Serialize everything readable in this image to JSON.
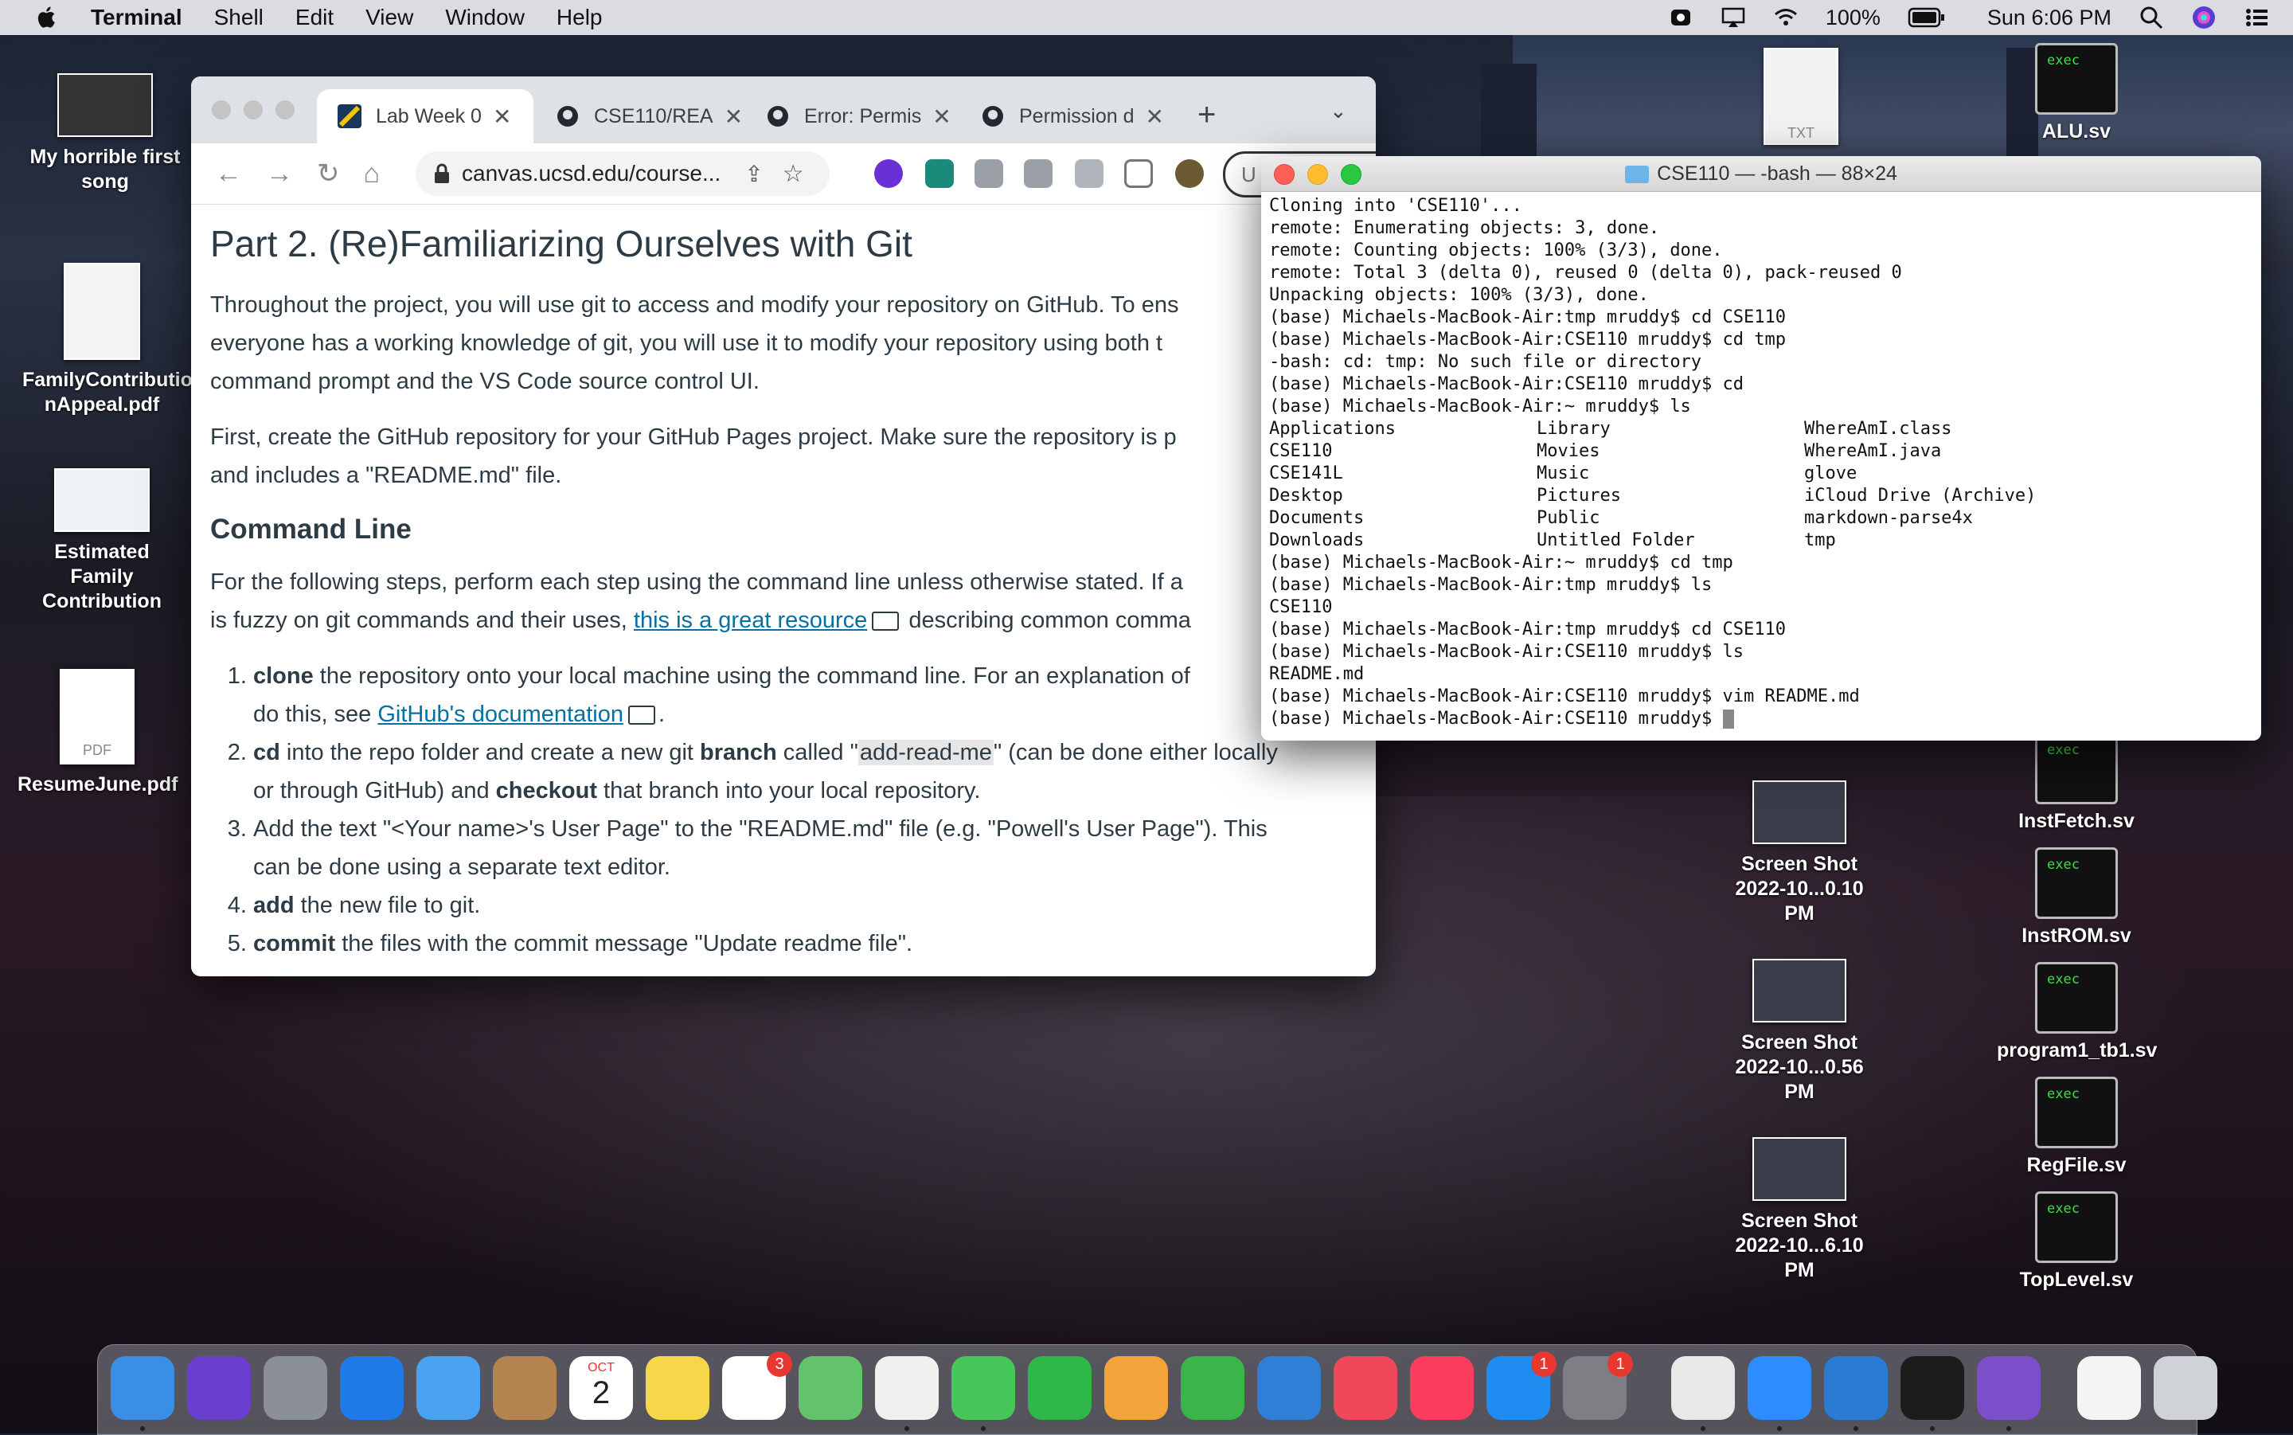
{
  "menubar": {
    "app": "Terminal",
    "items": [
      "Shell",
      "Edit",
      "View",
      "Window",
      "Help"
    ],
    "battery": "100%",
    "clock": "Sun 6:06 PM"
  },
  "desktop_left": [
    {
      "label_line1": "My horrible first",
      "label_line2": "song"
    },
    {
      "label_line1": "FamilyContributio",
      "label_line2": "nAppeal.pdf"
    },
    {
      "label_line1": "Estimated Family",
      "label_line2": "Contribution"
    },
    {
      "label_line1": "ResumeJune.pdf",
      "label_line2": "",
      "badge": "PDF"
    }
  ],
  "desktop_right": {
    "txt_badge": "TXT",
    "screenshots": [
      {
        "line1": "Screen Shot",
        "line2": "2022-10...0.10 PM"
      },
      {
        "line1": "Screen Shot",
        "line2": "2022-10...0.56 PM"
      },
      {
        "line1": "Screen Shot",
        "line2": "2022-10...6.10 PM"
      }
    ],
    "exec_label": "exec",
    "exec_files": [
      "ALU.sv",
      "InstFetch.sv",
      "InstROM.sv",
      "program1_tb1.sv",
      "RegFile.sv",
      "TopLevel.sv"
    ]
  },
  "browser": {
    "tabs": [
      {
        "label": "Lab Week 0"
      },
      {
        "label": "CSE110/REA"
      },
      {
        "label": "Error: Permis"
      },
      {
        "label": "Permission d"
      }
    ],
    "url": "canvas.ucsd.edu/course...",
    "omnibox_right": "U",
    "page": {
      "title": "Part 2. (Re)Familiarizing Ourselves with Git",
      "p1_l1": "Throughout the project, you will use git to access and modify your repository on GitHub. To ens",
      "p1_l2": "everyone has a working knowledge of git, you will use it to modify your repository using both t",
      "p1_l3": "command prompt and the VS Code source control UI.",
      "p2_l1": "First, create the GitHub repository for your GitHub Pages project. Make sure the repository is p",
      "p2_l2": "and includes a \"README.md\" file.",
      "h3": "Command Line",
      "p3_l1": "For the following steps, perform each step using the command line unless otherwise stated. If a",
      "p3_l2a": "is fuzzy on git commands and their uses,",
      "p3_link": "this is a great resource",
      "p3_l2b": "describing common comma",
      "li1_bold": "clone",
      "li1_l1": " the repository onto your local machine using the command line. For an explanation of",
      "li1_l2a": "do this, see ",
      "li1_link": "GitHub's documentation",
      "li2_bold1": "cd",
      "li2_a": " into the repo folder and create a new git ",
      "li2_bold2": "branch",
      "li2_b": " called \"",
      "li2_code": "add-read-me",
      "li2_c": "\" (can be done either locally",
      "li2_l2a": "or through GitHub) and ",
      "li2_bold3": "checkout",
      "li2_l2b": " that branch into your local repository.",
      "li3_l1": "Add the text \"<Your name>'s User Page\" to the \"README.md\" file (e.g. \"Powell's User Page\"). This",
      "li3_l2": "can be done using a separate text editor.",
      "li4_bold": "add",
      "li4_rest": " the new file to git.",
      "li5_bold": "commit",
      "li5_rest": " the files with the commit message \"Update readme file\"."
    }
  },
  "terminal": {
    "title": "CSE110 — -bash — 88×24",
    "lines_top": [
      "Cloning into 'CSE110'...",
      "remote: Enumerating objects: 3, done.",
      "remote: Counting objects: 100% (3/3), done.",
      "remote: Total 3 (delta 0), reused 0 (delta 0), pack-reused 0",
      "Unpacking objects: 100% (3/3), done.",
      "(base) Michaels-MacBook-Air:tmp mruddy$ cd CSE110",
      "(base) Michaels-MacBook-Air:CSE110 mruddy$ cd tmp",
      "-bash: cd: tmp: No such file or directory",
      "(base) Michaels-MacBook-Air:CSE110 mruddy$ cd",
      "(base) Michaels-MacBook-Air:~ mruddy$ ls"
    ],
    "ls_rows": [
      [
        "Applications",
        "Library",
        "WhereAmI.class"
      ],
      [
        "CSE110",
        "Movies",
        "WhereAmI.java"
      ],
      [
        "CSE141L",
        "Music",
        "glove"
      ],
      [
        "Desktop",
        "Pictures",
        "iCloud Drive (Archive)"
      ],
      [
        "Documents",
        "Public",
        "markdown-parse4x"
      ],
      [
        "Downloads",
        "Untitled Folder",
        "tmp"
      ]
    ],
    "lines_bottom": [
      "(base) Michaels-MacBook-Air:~ mruddy$ cd tmp",
      "(base) Michaels-MacBook-Air:tmp mruddy$ ls",
      "CSE110",
      "(base) Michaels-MacBook-Air:tmp mruddy$ cd CSE110",
      "(base) Michaels-MacBook-Air:CSE110 mruddy$ ls",
      "README.md",
      "(base) Michaels-MacBook-Air:CSE110 mruddy$ vim README.md"
    ],
    "prompt": "(base) Michaels-MacBook-Air:CSE110 mruddy$ "
  },
  "dock": {
    "apps": [
      {
        "name": "finder-icon",
        "color": "#3a8ee6"
      },
      {
        "name": "siri-icon",
        "color": "#6a3fd0"
      },
      {
        "name": "launchpad-icon",
        "color": "#8a8f99"
      },
      {
        "name": "safari-icon",
        "color": "#1e7ae6"
      },
      {
        "name": "mail-icon",
        "color": "#4aa3f0"
      },
      {
        "name": "contacts-icon",
        "color": "#b4844f"
      },
      {
        "name": "calendar-icon",
        "color": "#ffffff"
      },
      {
        "name": "notes-icon",
        "color": "#f7d74a"
      },
      {
        "name": "reminders-icon",
        "color": "#ffffff"
      },
      {
        "name": "maps-icon",
        "color": "#63c36b"
      },
      {
        "name": "photos-icon",
        "color": "#f0f0f0"
      },
      {
        "name": "messages-icon",
        "color": "#46c75a"
      },
      {
        "name": "facetime-icon",
        "color": "#2fb84a"
      },
      {
        "name": "pages-icon",
        "color": "#f2a33a"
      },
      {
        "name": "numbers-icon",
        "color": "#39b54a"
      },
      {
        "name": "keynote-icon",
        "color": "#2f7fd6"
      },
      {
        "name": "news-icon",
        "color": "#f0485a"
      },
      {
        "name": "music-icon",
        "color": "#fa3d5c"
      },
      {
        "name": "app-store-icon",
        "color": "#1e8cf0"
      },
      {
        "name": "system-preferences-icon",
        "color": "#7d7f85"
      },
      {
        "name": "chrome-icon",
        "color": "#e8e8e8"
      },
      {
        "name": "zoom-icon",
        "color": "#2d8cff"
      },
      {
        "name": "vscode-icon",
        "color": "#2a7bd4"
      },
      {
        "name": "terminal-icon",
        "color": "#1c1c1c"
      },
      {
        "name": "github-desktop-icon",
        "color": "#7a4fc9"
      },
      {
        "name": "document-icon",
        "color": "#f4f4f4"
      },
      {
        "name": "trash-icon",
        "color": "#cfd3d8"
      }
    ],
    "calendar_month": "OCT",
    "calendar_day": "2",
    "badge_reminders": "3",
    "badge_appstore": "1",
    "badge_sysprefs": "1"
  }
}
